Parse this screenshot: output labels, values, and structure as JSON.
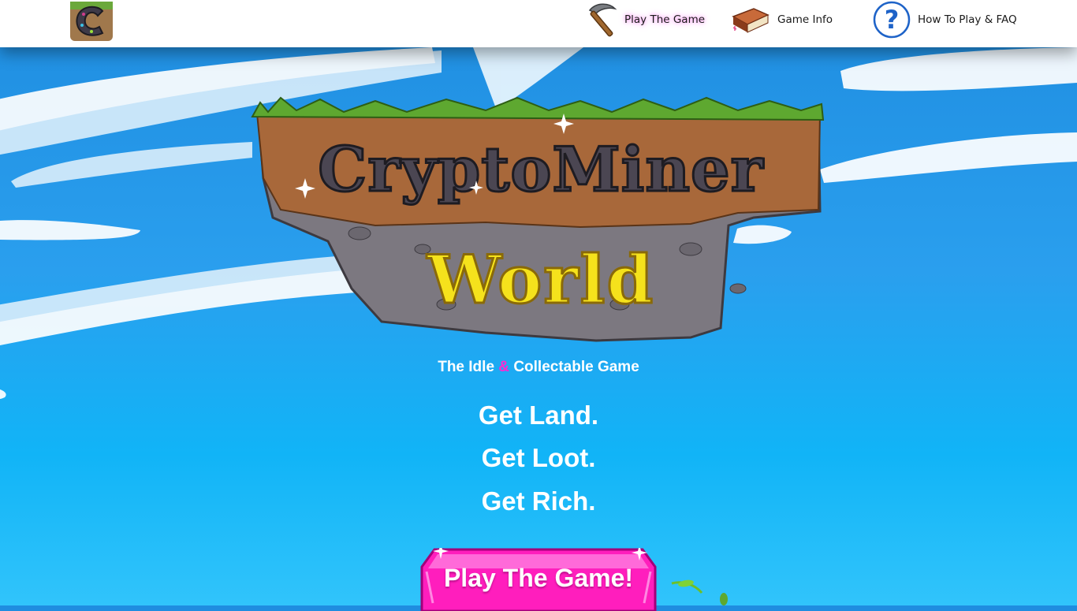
{
  "header": {
    "nav": {
      "play_label": "Play The Game",
      "info_label": "Game Info",
      "faq_label": "How To Play & FAQ"
    }
  },
  "hero": {
    "logo_line1": "CryptoMiner",
    "logo_line2": "World",
    "tagline_part1": "The Idle",
    "tagline_amp": "&",
    "tagline_part2": "Collectable Game",
    "slogans": [
      "Get Land.",
      "Get Loot.",
      "Get Rich."
    ],
    "cta_label": "Play The Game!"
  },
  "icons": {
    "site_logo": "c-logo-icon",
    "play": "pickaxe-icon",
    "info": "book-icon",
    "faq": "question-icon"
  },
  "colors": {
    "accent_pink": "#ff2ad0",
    "button_pink": "#ff1ebd",
    "sky_blue": "#2a9fee"
  }
}
